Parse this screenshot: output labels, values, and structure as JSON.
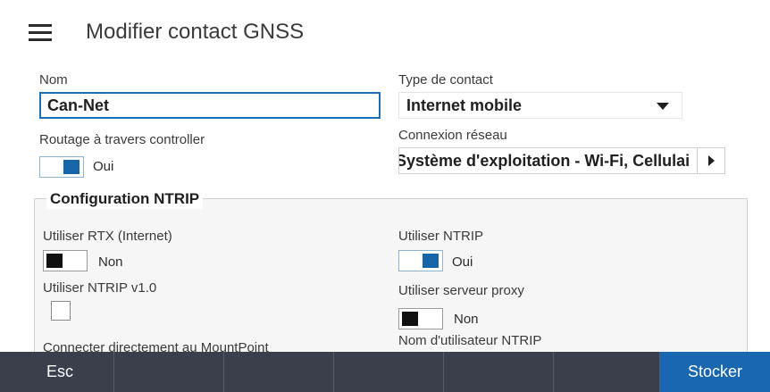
{
  "header": {
    "menu_icon": "hamburger-menu-icon",
    "title": "Modifier contact GNSS"
  },
  "form": {
    "name_label": "Nom",
    "name_value": "Can-Net",
    "contact_type_label": "Type de contact",
    "contact_type_value": "Internet mobile",
    "routing_label": "Routage à travers controller",
    "routing_toggle": {
      "on": true,
      "text": "Oui"
    },
    "network_label": "Connexion réseau",
    "network_value": "Système d'exploitation - Wi-Fi, Cellulai"
  },
  "ntrip": {
    "title": "Configuration NTRIP",
    "use_rtx_label": "Utiliser RTX (Internet)",
    "use_rtx_toggle": {
      "on": false,
      "text": "Non"
    },
    "use_ntrip_v1_label": "Utiliser NTRIP v1.0",
    "use_ntrip_v1_checked": false,
    "connect_mountpoint_label": "Connecter directement au MountPoint",
    "use_ntrip_label": "Utiliser NTRIP",
    "use_ntrip_toggle": {
      "on": true,
      "text": "Oui"
    },
    "use_proxy_label": "Utiliser serveur proxy",
    "use_proxy_toggle": {
      "on": false,
      "text": "Non"
    },
    "ntrip_user_label": "Nom d'utilisateur NTRIP"
  },
  "bottom_bar": {
    "esc_label": "Esc",
    "store_label": "Stocker"
  },
  "colors": {
    "accent": "#1765a8",
    "bottom_bar": "#3a3f4b",
    "store_button": "#1867b0"
  }
}
